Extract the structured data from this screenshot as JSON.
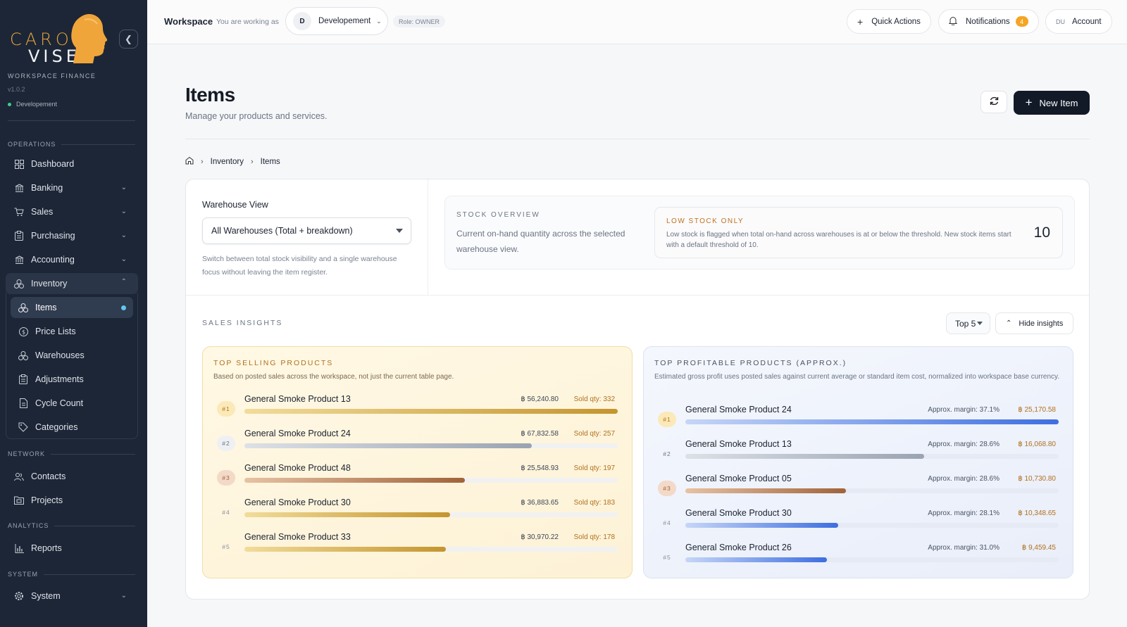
{
  "sidebar": {
    "logo_top": "CARO",
    "logo_bottom": "VISE",
    "workspace_title": "WORKSPACE FINANCE",
    "version": "v1.0.2",
    "environment": "Developement",
    "sections": {
      "operations": "OPERATIONS",
      "network": "NETWORK",
      "analytics": "ANALYTICS",
      "system": "SYSTEM"
    },
    "items": {
      "dashboard": "Dashboard",
      "banking": "Banking",
      "sales": "Sales",
      "purchasing": "Purchasing",
      "accounting": "Accounting",
      "inventory": "Inventory",
      "contacts": "Contacts",
      "projects": "Projects",
      "reports": "Reports",
      "system": "System"
    },
    "inventory_sub": {
      "items": "Items",
      "price_lists": "Price Lists",
      "warehouses": "Warehouses",
      "adjustments": "Adjustments",
      "cycle_count": "Cycle Count",
      "categories": "Categories"
    }
  },
  "topbar": {
    "workspace": "Workspace",
    "working_as": "You are working as",
    "ws_initial": "D",
    "ws_name": "Developement",
    "role": "Role: OWNER",
    "quick_actions": "Quick Actions",
    "notifications": "Notifications",
    "notification_count": "4",
    "account_initials": "DU",
    "account": "Account"
  },
  "header": {
    "title": "Items",
    "subtitle": "Manage your products and services.",
    "new_item": "New Item"
  },
  "breadcrumb": {
    "inventory": "Inventory",
    "items": "Items"
  },
  "warehouse": {
    "label": "Warehouse View",
    "selected": "All Warehouses (Total + breakdown)",
    "help": "Switch between total stock visibility and a single warehouse focus without leaving the item register."
  },
  "stock_overview": {
    "title": "STOCK OVERVIEW",
    "desc": "Current on-hand quantity across the selected warehouse view.",
    "low_title": "LOW STOCK ONLY",
    "low_desc": "Low stock is flagged when total on-hand across warehouses is at or below the threshold. New stock items start with a default threshold of 10.",
    "low_value": "10"
  },
  "insights": {
    "title": "SALES INSIGHTS",
    "top_n": "Top 5",
    "hide": "Hide insights",
    "selling": {
      "title": "TOP SELLING PRODUCTS",
      "desc": "Based on posted sales across the workspace, not just the current table page.",
      "rows": [
        {
          "rank": "#1",
          "name": "General Smoke Product 13",
          "amount": "฿ 56,240.80",
          "extra": "Sold qty: 332",
          "share": 1.0
        },
        {
          "rank": "#2",
          "name": "General Smoke Product 24",
          "amount": "฿ 67,832.58",
          "extra": "Sold qty: 257",
          "share": 0.77
        },
        {
          "rank": "#3",
          "name": "General Smoke Product 48",
          "amount": "฿ 25,548.93",
          "extra": "Sold qty: 197",
          "share": 0.59
        },
        {
          "rank": "#4",
          "name": "General Smoke Product 30",
          "amount": "฿ 36,883.65",
          "extra": "Sold qty: 183",
          "share": 0.55
        },
        {
          "rank": "#5",
          "name": "General Smoke Product 33",
          "amount": "฿ 30,970.22",
          "extra": "Sold qty: 178",
          "share": 0.54
        }
      ]
    },
    "profitable": {
      "title": "TOP PROFITABLE PRODUCTS (APPROX.)",
      "desc": "Estimated gross profit uses posted sales against current average or standard item cost, normalized into workspace base currency.",
      "rows": [
        {
          "rank": "#1",
          "name": "General Smoke Product 24",
          "amount": "฿ 25,170.58",
          "extra": "Approx. margin: 37.1%",
          "share": 1.0
        },
        {
          "rank": "#2",
          "name": "General Smoke Product 13",
          "amount": "฿ 16,068.80",
          "extra": "Approx. margin: 28.6%",
          "share": 0.64
        },
        {
          "rank": "#3",
          "name": "General Smoke Product 05",
          "amount": "฿ 10,730.80",
          "extra": "Approx. margin: 28.6%",
          "share": 0.43
        },
        {
          "rank": "#4",
          "name": "General Smoke Product 30",
          "amount": "฿ 10,348.65",
          "extra": "Approx. margin: 28.1%",
          "share": 0.41
        },
        {
          "rank": "#5",
          "name": "General Smoke Product 26",
          "amount": "฿ 9,459.45",
          "extra": "Approx. margin: 31.0%",
          "share": 0.38
        }
      ]
    }
  },
  "colors": {
    "sidebar_bg": "#1c2636",
    "accent_orange": "#e8a43c",
    "primary_dark": "#121a28",
    "gold_bar": "#c4952f",
    "silver_bar": "#9aa3b1",
    "bronze_bar": "#a0633a",
    "blue_bar": "#3d6ee0"
  }
}
